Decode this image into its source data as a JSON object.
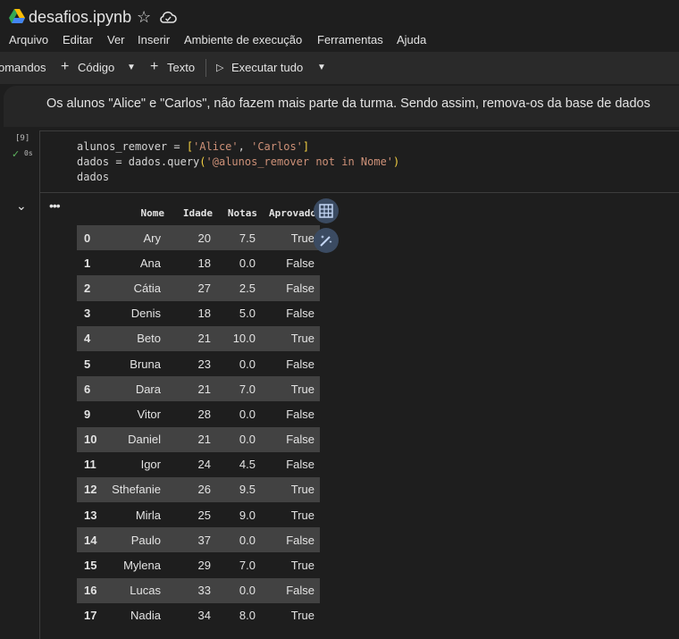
{
  "header": {
    "filename": "desafios.ipynb",
    "star_icon": "star-icon",
    "cloud_icon": "cloud-icon"
  },
  "menu": [
    "Arquivo",
    "Editar",
    "Ver",
    "Inserir",
    "Ambiente de execução",
    "Ferramentas",
    "Ajuda"
  ],
  "toolbar": {
    "commands": "omandos",
    "code": "Código",
    "text": "Texto",
    "run_all": "Executar tudo"
  },
  "text_cell": {
    "content": "Os alunos \"Alice\" e \"Carlos\", não fazem mais parte da turma. Sendo assim, remova-os da base de dados"
  },
  "code_cell": {
    "exec_count": "[9]",
    "exec_time": "0s",
    "line1_a": "alunos_remover = ",
    "line1_b": "[",
    "line1_c": "'Alice'",
    "line1_d": ", ",
    "line1_e": "'Carlos'",
    "line1_f": "]",
    "line2_a": "dados = dados.query",
    "line2_b": "(",
    "line2_c": "'@alunos_remover not in Nome'",
    "line2_d": ")",
    "line3": "dados"
  },
  "table": {
    "columns": [
      "",
      "Nome",
      "Idade",
      "Notas",
      "Aprovado"
    ],
    "rows": [
      [
        "0",
        "Ary",
        "20",
        "7.5",
        "True"
      ],
      [
        "1",
        "Ana",
        "18",
        "0.0",
        "False"
      ],
      [
        "2",
        "Cátia",
        "27",
        "2.5",
        "False"
      ],
      [
        "3",
        "Denis",
        "18",
        "5.0",
        "False"
      ],
      [
        "4",
        "Beto",
        "21",
        "10.0",
        "True"
      ],
      [
        "5",
        "Bruna",
        "23",
        "0.0",
        "False"
      ],
      [
        "6",
        "Dara",
        "21",
        "7.0",
        "True"
      ],
      [
        "9",
        "Vitor",
        "28",
        "0.0",
        "False"
      ],
      [
        "10",
        "Daniel",
        "21",
        "0.0",
        "False"
      ],
      [
        "11",
        "Igor",
        "24",
        "4.5",
        "False"
      ],
      [
        "12",
        "Sthefanie",
        "26",
        "9.5",
        "True"
      ],
      [
        "13",
        "Mirla",
        "25",
        "9.0",
        "True"
      ],
      [
        "14",
        "Paulo",
        "37",
        "0.0",
        "False"
      ],
      [
        "15",
        "Mylena",
        "29",
        "7.0",
        "True"
      ],
      [
        "16",
        "Lucas",
        "33",
        "0.0",
        "False"
      ],
      [
        "17",
        "Nadia",
        "34",
        "8.0",
        "True"
      ]
    ]
  },
  "colors": {
    "background": "#1e1e1e",
    "even_row": "#424242",
    "string": "#ce9178",
    "bracket": "#f5d142",
    "check": "#5fb760",
    "side_button": "#3b4b62"
  }
}
